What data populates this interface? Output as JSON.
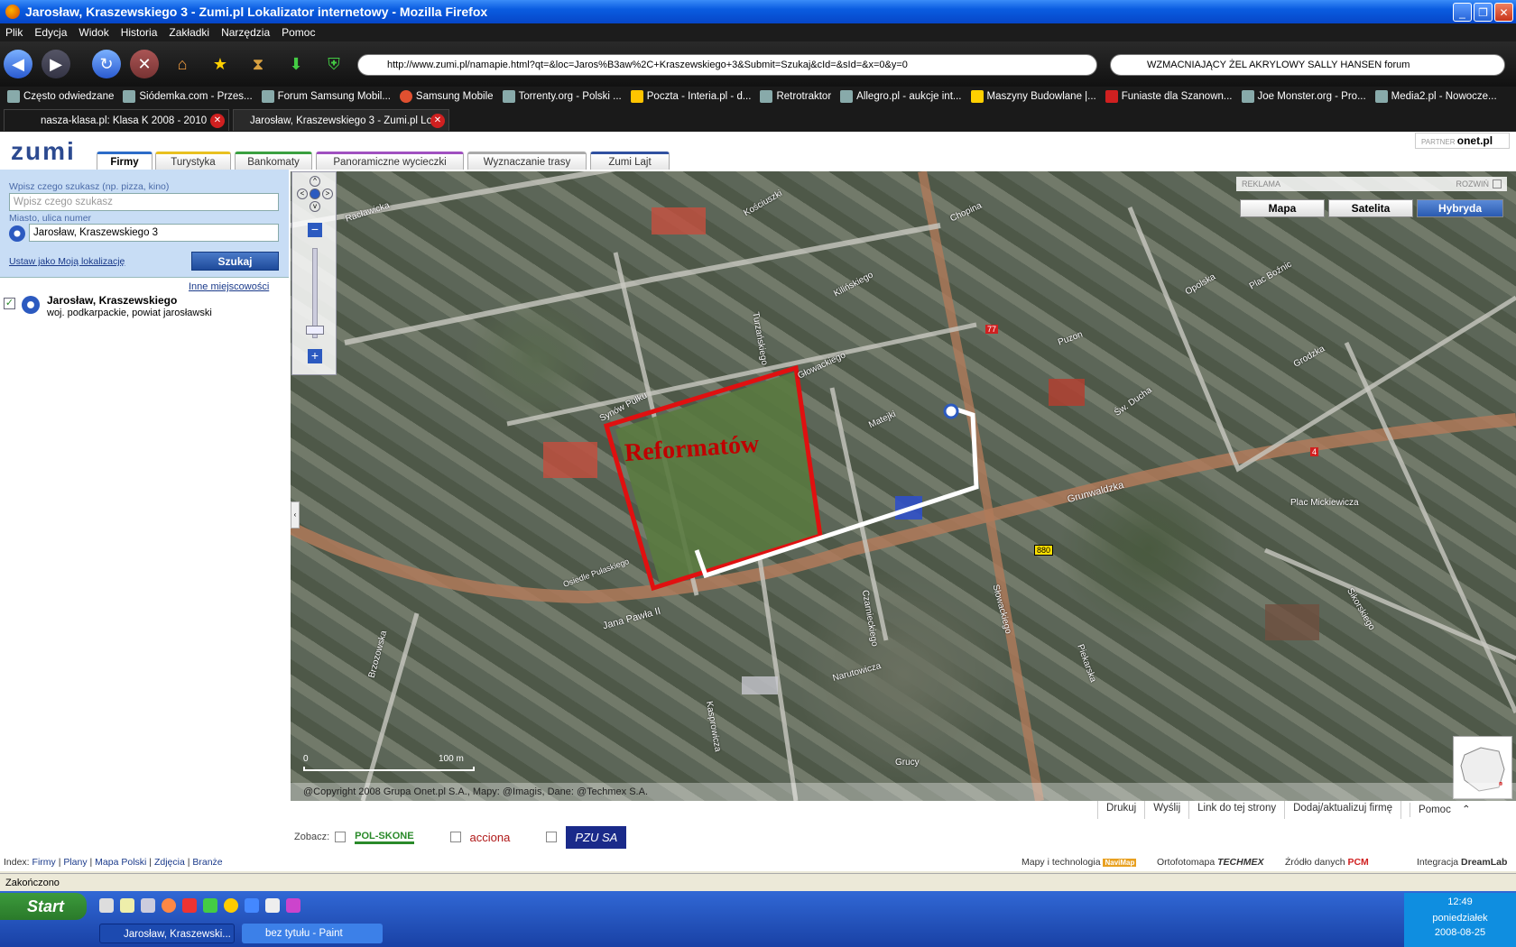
{
  "window": {
    "title": "Jarosław, Kraszewskiego 3 - Zumi.pl Lokalizator internetowy - Mozilla Firefox"
  },
  "menu": [
    "Plik",
    "Edycja",
    "Widok",
    "Historia",
    "Zakładki",
    "Narzędzia",
    "Pomoc"
  ],
  "address": {
    "url": "http://www.zumi.pl/namapie.html?qt=&loc=Jaros%B3aw%2C+Kraszewskiego+3&Submit=Szukaj&cId=&sId=&x=0&y=0",
    "search": "WZMACNIAJĄCY ŻEL AKRYLOWY SALLY HANSEN forum"
  },
  "bookmarks": [
    "Często odwiedzane",
    "Siódemka.com - Przes...",
    "Forum Samsung Mobil...",
    "Samsung Mobile",
    "Torrenty.org - Polski ...",
    "Poczta - Interia.pl - d...",
    "Retrotraktor",
    "Allegro.pl - aukcje int...",
    "Maszyny Budowlane |...",
    "Funiaste dla Szanown...",
    "Joe Monster.org - Pro...",
    "Media2.pl - Nowocze..."
  ],
  "tabs": [
    {
      "label": "nasza-klasa.pl: Klasa K 2008 - 2010"
    },
    {
      "label": "Jarosław, Kraszewskiego 3 - Zumi.pl Lo..."
    }
  ],
  "zumi": {
    "logo": "zumi",
    "tabs": [
      "Firmy",
      "Turystyka",
      "Bankomaty",
      "Panoramiczne wycieczki",
      "Wyznaczanie trasy",
      "Zumi Lajt"
    ],
    "partner_label": "PARTNER",
    "partner_name": "onet.pl"
  },
  "search": {
    "what_label": "Wpisz czego szukasz (np. pizza, kino)",
    "what_placeholder": "Wpisz czego szukasz",
    "where_label": "Miasto, ulica numer",
    "where_value": "Jarosław, Kraszewskiego 3",
    "set_location": "Ustaw jako Moją lokalizację",
    "button": "Szukaj",
    "other_places": "Inne miejscowości"
  },
  "result": {
    "title": "Jarosław, Kraszewskiego",
    "subtitle": "woj. podkarpackie, powiat jarosławski"
  },
  "map": {
    "ad_label": "REKLAMA",
    "expand_label": "ROZWIŃ",
    "types": [
      "Mapa",
      "Satelita",
      "Hybryda"
    ],
    "annotation": "Reformatów",
    "streets": [
      "Racławicka",
      "Kościuszki",
      "Chopina",
      "Kilińskiego",
      "Turzańskiego",
      "Głowackiego",
      "Matejki",
      "Synów Pułku",
      "Grunwaldzka",
      "Jana Pawła II",
      "Słowackiego",
      "Narutowicza",
      "Kasprowicza",
      "Czarnieckiego",
      "Piekarska",
      "Sikorskiego",
      "Plac Mickiewicza",
      "Plac Boźnic",
      "Opolska",
      "Grodzka",
      "Św. Ducha",
      "Osiedle Pułaskiego",
      "Brzozowska",
      "Grucy",
      "Puzon"
    ],
    "road_badges": [
      "77",
      "4",
      "880"
    ],
    "scale_start": "0",
    "scale_end": "100 m",
    "copyright": "@Copyright 2008 Grupa Onet.pl S.A., Mapy: @Imagis, Dane: @Techmex S.A."
  },
  "actions": [
    "Drukuj",
    "Wyślij",
    "Link do tej strony",
    "Dodaj/aktualizuj firmę",
    "Pomoc"
  ],
  "zobacz": {
    "label": "Zobacz:",
    "sponsors": [
      "POL-SKONE",
      "acciona",
      "PZU SA"
    ]
  },
  "footer": {
    "index_label": "Index:",
    "links": [
      "Firmy",
      "Plany",
      "Mapa Polski",
      "Zdjęcia",
      "Branże"
    ],
    "credits": [
      "Mapy i technologia",
      "Ortofotomapa",
      "Źródło danych",
      "Integracja"
    ]
  },
  "status": "Zakończono",
  "taskbar": {
    "start": "Start",
    "items": [
      "Jarosław, Kraszewski...",
      "bez tytułu - Paint"
    ],
    "time": "12:49",
    "day": "poniedziałek",
    "date": "2008-08-25"
  }
}
